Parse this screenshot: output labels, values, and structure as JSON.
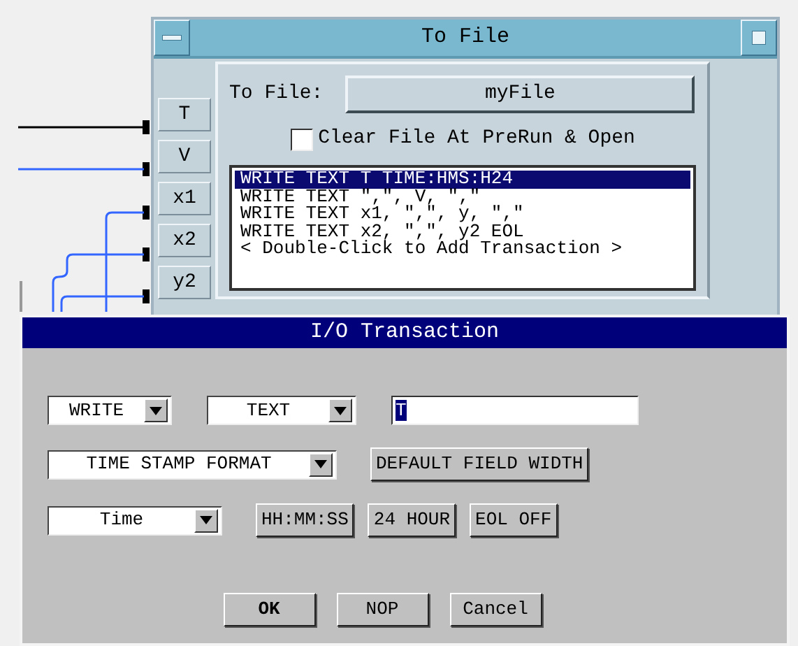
{
  "to_file_window": {
    "title": "To File",
    "file_label": "To File:",
    "file_button": "myFile",
    "clear_option": {
      "label": "Clear File At PreRun & Open",
      "checked": false
    },
    "inputs": [
      "T",
      "V",
      "x1",
      "x2",
      "y2"
    ],
    "transactions": [
      {
        "text": "WRITE TEXT T TIME:HMS:H24",
        "selected": true
      },
      {
        "text": "WRITE TEXT \",\", V, \",\"",
        "selected": false
      },
      {
        "text": "WRITE TEXT x1, \",\", y, \",\"",
        "selected": false
      },
      {
        "text": "WRITE TEXT x2, \",\", y2 EOL",
        "selected": false
      },
      {
        "text": "< Double-Click to Add Transaction >",
        "selected": false
      }
    ]
  },
  "io_dialog": {
    "title": "I/O Transaction",
    "action": "WRITE",
    "encoding": "TEXT",
    "expression": "T",
    "format": "TIME STAMP FORMAT",
    "field_width_button": "DEFAULT FIELD WIDTH",
    "time_field": "Time",
    "option_buttons": [
      "HH:MM:SS",
      "24 HOUR",
      "EOL OFF"
    ],
    "buttons": [
      {
        "label": "OK",
        "default": true
      },
      {
        "label": "NOP",
        "default": false
      },
      {
        "label": "Cancel",
        "default": false
      }
    ]
  }
}
